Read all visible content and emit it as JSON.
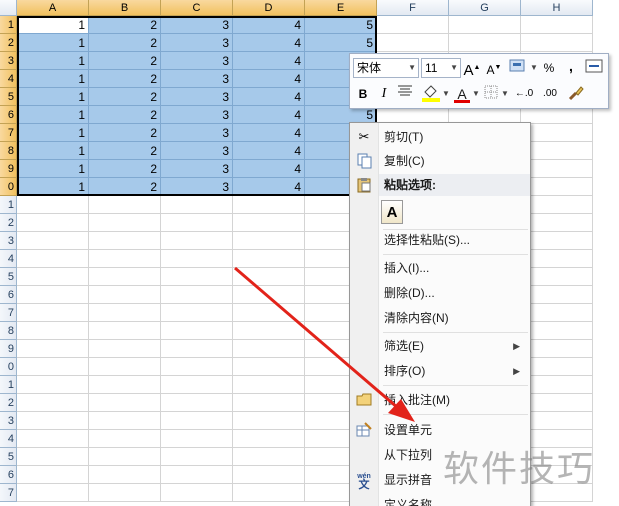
{
  "columns": [
    "A",
    "B",
    "C",
    "D",
    "E",
    "F",
    "G",
    "H"
  ],
  "row_numbers": [
    "1",
    "2",
    "3",
    "4",
    "5",
    "6",
    "7",
    "8",
    "9",
    "0",
    "1",
    "2",
    "3",
    "4",
    "5",
    "6",
    "7",
    "8",
    "9",
    "0",
    "1",
    "2",
    "3",
    "4",
    "5",
    "6",
    "7"
  ],
  "row_values": [
    1,
    2,
    3,
    4,
    5
  ],
  "mini_toolbar": {
    "font_name": "宋体",
    "font_size": "11",
    "grow_font": "A",
    "shrink_font": "A",
    "percent": "%",
    "comma": ",",
    "bold": "B",
    "italic": "I",
    "font_color_label": "A",
    "decimal_inc": "←.0",
    "decimal_dec": ".00",
    "highlight_color": "#ffff00",
    "font_color": "#e00000"
  },
  "context_menu": {
    "items": [
      {
        "label": "剪切(T)",
        "icon": "scissors-icon"
      },
      {
        "label": "复制(C)",
        "icon": "copy-icon"
      },
      {
        "label": "粘贴选项:",
        "icon": "paste-icon"
      },
      {
        "label": "A",
        "icon": "paste-values-icon"
      },
      {
        "label": "选择性粘贴(S)...",
        "icon": ""
      },
      {
        "label": "插入(I)...",
        "icon": ""
      },
      {
        "label": "删除(D)...",
        "icon": ""
      },
      {
        "label": "清除内容(N)",
        "icon": ""
      },
      {
        "label": "筛选(E)",
        "icon": ""
      },
      {
        "label": "排序(O)",
        "icon": ""
      },
      {
        "label": "插入批注(M)",
        "icon": "comment-icon"
      },
      {
        "label": "设置单元",
        "icon": "format-cells-icon"
      },
      {
        "label": "从下拉列",
        "icon": ""
      },
      {
        "label": "显示拼音",
        "icon": "pinyin-icon"
      },
      {
        "label": "定义名称",
        "icon": ""
      }
    ]
  },
  "watermark": "软件技巧",
  "colors": {
    "selection": "#a6c9ea",
    "arrow": "#e2231a",
    "header_selected": "#f1c15f"
  }
}
